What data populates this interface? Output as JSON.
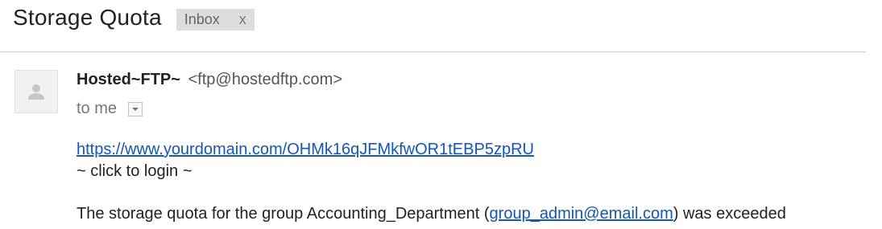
{
  "message": {
    "subject": "Storage Quota",
    "label": {
      "name": "Inbox",
      "close": "x"
    },
    "sender": {
      "name": "Hosted~FTP~",
      "email": "<ftp@hostedftp.com>",
      "avatar_icon": "person-icon"
    },
    "recipient_line": "to me",
    "details_icon": "dropdown-arrow-icon"
  },
  "body": {
    "link_url": "https://www.yourdomain.com/OHMk16qJFMkfwOR1tEBP5zpRU",
    "login_text": "~ click to login ~",
    "quota_prefix": "The storage quota for the group Accounting_Department (",
    "quota_email": "group_admin@email.com",
    "quota_suffix": ") was exceeded"
  },
  "colors": {
    "link": "#1155cc",
    "chip_bg": "#dddddd",
    "muted_text": "#777777"
  }
}
